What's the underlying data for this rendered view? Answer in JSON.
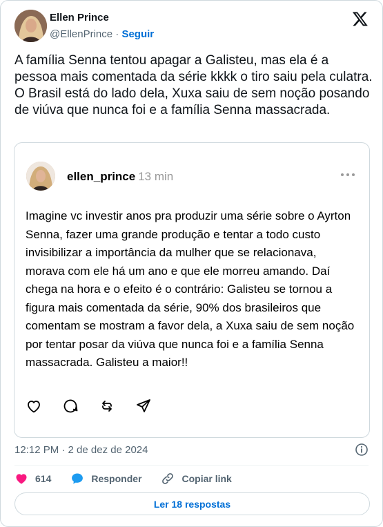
{
  "author": {
    "name": "Ellen Prince",
    "handle": "@EllenPrince",
    "separator": " · ",
    "follow_label": "Seguir"
  },
  "tweet": {
    "text": "A família Senna tentou apagar a Galisteu, mas ela é a pessoa mais comentada da série kkkk o tiro saiu pela culatra. O Brasil está do lado dela, Xuxa saiu de sem noção posando de viúva que nunca foi e a família Senna massacrada."
  },
  "embed": {
    "username": "ellen_prince",
    "time": "13 min",
    "text": "Imagine vc investir anos pra produzir uma série sobre o Ayrton Senna, fazer uma grande produção e tentar a todo custo invisibilizar a importância da mulher que se relacionava, morava com ele há um ano e que ele morreu amando. Daí chega na hora e o efeito é o contrário: Galisteu se tornou a figura mais comentada da série, 90% dos brasileiros que comentam se mostram a favor dela, a Xuxa saiu de sem noção por tentar posar da viúva que nunca foi e a família Senna massacrada. Galisteu a maior!!"
  },
  "meta": {
    "timestamp": "12:12 PM · 2 de dez de 2024"
  },
  "stats": {
    "likes": "614",
    "reply_label": "Responder",
    "copy_label": "Copiar link"
  },
  "replies": {
    "label": "Ler 18 respostas"
  },
  "colors": {
    "link": "#006fd6",
    "like": "#f91880",
    "reply": "#1d9bf0",
    "muted": "#536471"
  }
}
